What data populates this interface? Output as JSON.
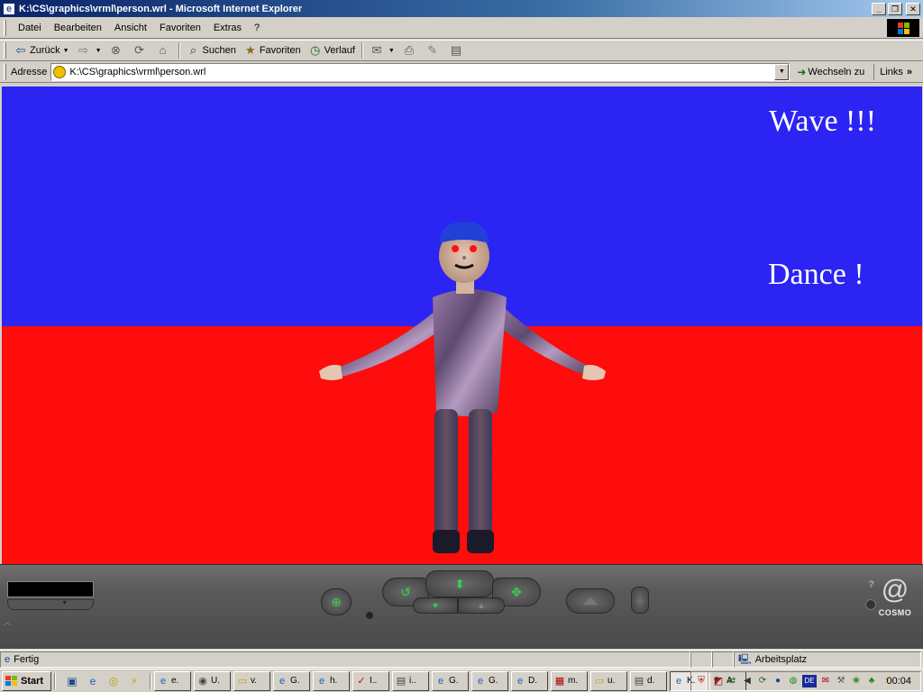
{
  "window": {
    "title": "K:\\CS\\graphics\\vrml\\person.wrl - Microsoft Internet Explorer"
  },
  "menu": {
    "items": [
      "Datei",
      "Bearbeiten",
      "Ansicht",
      "Favoriten",
      "Extras",
      "?"
    ]
  },
  "toolbar": {
    "back": "Zurück",
    "search": "Suchen",
    "favorites": "Favoriten",
    "history": "Verlauf"
  },
  "address": {
    "label": "Adresse",
    "value": "K:\\CS\\graphics\\vrml\\person.wrl",
    "go": "Wechseln zu",
    "links": "Links"
  },
  "scene": {
    "wave_text": "Wave !!!",
    "dance_text": "Dance !",
    "sky_color": "#2b24f2",
    "ground_color": "#ff0c0c",
    "sweater_color": "#7a5a8a"
  },
  "cosmo": {
    "logo_text": "COSMO",
    "help": "?"
  },
  "status": {
    "text": "Fertig",
    "zone": "Arbeitsplatz"
  },
  "taskbar": {
    "start": "Start",
    "tasks": [
      {
        "icon": "ie-icon",
        "label": "e."
      },
      {
        "icon": "app-icon",
        "label": "U."
      },
      {
        "icon": "folder-icon",
        "label": "v."
      },
      {
        "icon": "ie-icon",
        "label": "G."
      },
      {
        "icon": "ie-icon",
        "label": "h."
      },
      {
        "icon": "app-icon",
        "label": "I.."
      },
      {
        "icon": "app-icon",
        "label": "i.."
      },
      {
        "icon": "ie-icon",
        "label": "G."
      },
      {
        "icon": "ie-icon",
        "label": "G."
      },
      {
        "icon": "ie-icon",
        "label": "D."
      },
      {
        "icon": "app-icon",
        "label": "m."
      },
      {
        "icon": "folder-icon",
        "label": "u."
      },
      {
        "icon": "app-icon",
        "label": "d."
      },
      {
        "icon": "ie-icon",
        "label": "K."
      },
      {
        "icon": "app-icon",
        "label": "A."
      }
    ],
    "lang": "DE",
    "clock": "00:04"
  }
}
